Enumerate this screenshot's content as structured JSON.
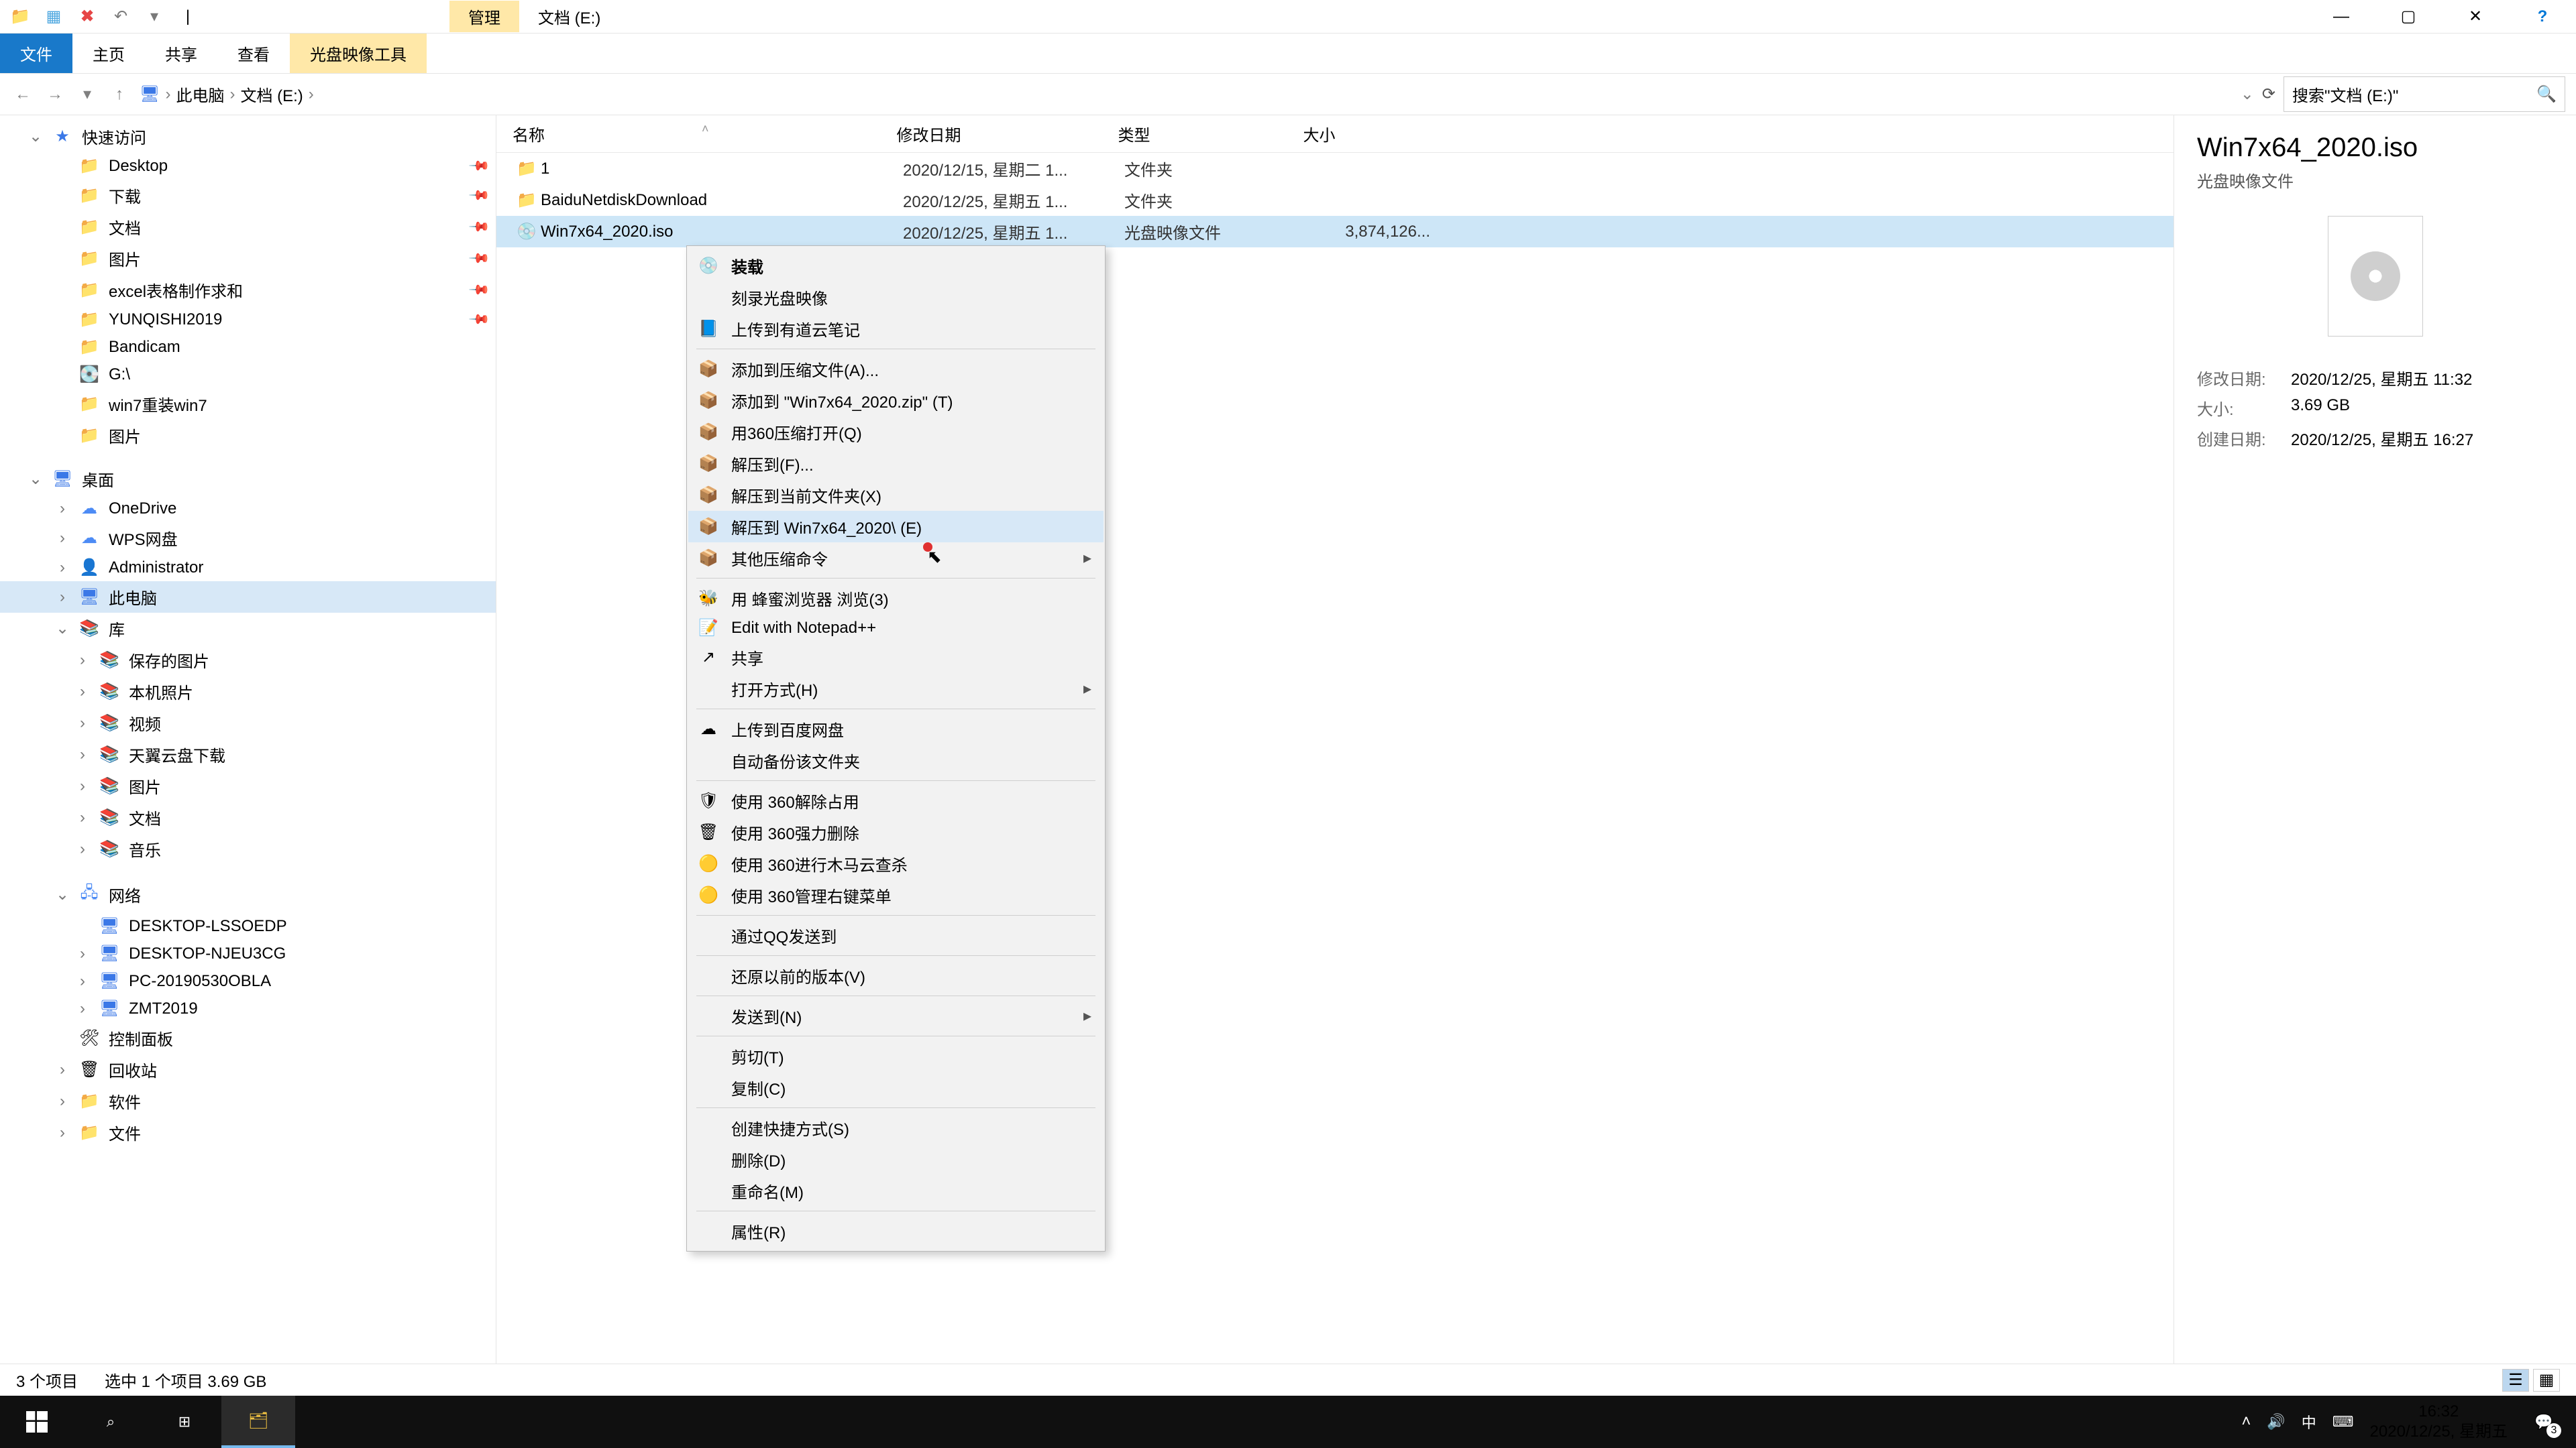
{
  "title_tab": "管理",
  "title_path": "文档 (E:)",
  "win_controls": {
    "min": "—",
    "max": "▢",
    "close": "✕",
    "help": "?"
  },
  "ribbon": {
    "file": "文件",
    "home": "主页",
    "share": "共享",
    "view": "查看",
    "context": "光盘映像工具"
  },
  "nav": {
    "back": "←",
    "forward": "→",
    "up": "↑"
  },
  "breadcrumb": [
    "此电脑",
    "文档 (E:)"
  ],
  "search_placeholder": "搜索\"文档 (E:)\"",
  "columns": {
    "name": "名称",
    "date": "修改日期",
    "type": "类型",
    "size": "大小"
  },
  "rows": [
    {
      "icon": "folder",
      "name": "1",
      "date": "2020/12/15, 星期二 1...",
      "type": "文件夹",
      "size": ""
    },
    {
      "icon": "folder",
      "name": "BaiduNetdiskDownload",
      "date": "2020/12/25, 星期五 1...",
      "type": "文件夹",
      "size": ""
    },
    {
      "icon": "iso",
      "name": "Win7x64_2020.iso",
      "date": "2020/12/25, 星期五 1...",
      "type": "光盘映像文件",
      "size": "3,874,126..."
    }
  ],
  "tree": [
    {
      "d": 0,
      "icon": "star",
      "label": "快速访问",
      "chev": "v"
    },
    {
      "d": 1,
      "icon": "folder-blue",
      "label": "Desktop",
      "pin": true
    },
    {
      "d": 1,
      "icon": "folder-blue",
      "label": "下载",
      "pin": true
    },
    {
      "d": 1,
      "icon": "folder-blue",
      "label": "文档",
      "pin": true
    },
    {
      "d": 1,
      "icon": "folder-blue",
      "label": "图片",
      "pin": true
    },
    {
      "d": 1,
      "icon": "folder-yellow",
      "label": "excel表格制作求和",
      "pin": true
    },
    {
      "d": 1,
      "icon": "folder-yellow",
      "label": "YUNQISHI2019",
      "pin": true
    },
    {
      "d": 1,
      "icon": "folder-yellow",
      "label": "Bandicam"
    },
    {
      "d": 1,
      "icon": "drive",
      "label": "G:\\"
    },
    {
      "d": 1,
      "icon": "folder-yellow",
      "label": "win7重装win7"
    },
    {
      "d": 1,
      "icon": "folder-yellow",
      "label": "图片"
    },
    {
      "d": 0,
      "icon": "monitor",
      "label": "桌面",
      "chev": "v"
    },
    {
      "d": 1,
      "icon": "cloud",
      "label": "OneDrive",
      "chev": ">"
    },
    {
      "d": 1,
      "icon": "cloud",
      "label": "WPS网盘",
      "chev": ">"
    },
    {
      "d": 1,
      "icon": "user",
      "label": "Administrator",
      "chev": ">"
    },
    {
      "d": 1,
      "icon": "monitor",
      "label": "此电脑",
      "sel": true,
      "chev": ">"
    },
    {
      "d": 1,
      "icon": "lib",
      "label": "库",
      "chev": "v"
    },
    {
      "d": 2,
      "icon": "lib",
      "label": "保存的图片",
      "chev": ">"
    },
    {
      "d": 2,
      "icon": "lib",
      "label": "本机照片",
      "chev": ">"
    },
    {
      "d": 2,
      "icon": "lib",
      "label": "视频",
      "chev": ">"
    },
    {
      "d": 2,
      "icon": "lib",
      "label": "天翼云盘下载",
      "chev": ">"
    },
    {
      "d": 2,
      "icon": "lib",
      "label": "图片",
      "chev": ">"
    },
    {
      "d": 2,
      "icon": "lib",
      "label": "文档",
      "chev": ">"
    },
    {
      "d": 2,
      "icon": "lib",
      "label": "音乐",
      "chev": ">"
    },
    {
      "d": 1,
      "icon": "net",
      "label": "网络",
      "chev": "v"
    },
    {
      "d": 2,
      "icon": "monitor",
      "label": "DESKTOP-LSSOEDP"
    },
    {
      "d": 2,
      "icon": "monitor",
      "label": "DESKTOP-NJEU3CG",
      "chev": ">"
    },
    {
      "d": 2,
      "icon": "monitor",
      "label": "PC-20190530OBLA",
      "chev": ">"
    },
    {
      "d": 2,
      "icon": "monitor",
      "label": "ZMT2019",
      "chev": ">"
    },
    {
      "d": 1,
      "icon": "panel",
      "label": "控制面板"
    },
    {
      "d": 1,
      "icon": "bin",
      "label": "回收站",
      "chev": ">"
    },
    {
      "d": 1,
      "icon": "folder-yellow",
      "label": "软件",
      "chev": ">"
    },
    {
      "d": 1,
      "icon": "folder-yellow",
      "label": "文件",
      "chev": ">"
    }
  ],
  "ctx": [
    {
      "t": "item",
      "icon": "disc",
      "label": "装载",
      "bold": true
    },
    {
      "t": "item",
      "label": "刻录光盘映像"
    },
    {
      "t": "item",
      "icon": "note",
      "label": "上传到有道云笔记"
    },
    {
      "t": "sep"
    },
    {
      "t": "item",
      "icon": "zip",
      "label": "添加到压缩文件(A)..."
    },
    {
      "t": "item",
      "icon": "zip",
      "label": "添加到 \"Win7x64_2020.zip\" (T)"
    },
    {
      "t": "item",
      "icon": "zip",
      "label": "用360压缩打开(Q)"
    },
    {
      "t": "item",
      "icon": "zip",
      "label": "解压到(F)..."
    },
    {
      "t": "item",
      "icon": "zip",
      "label": "解压到当前文件夹(X)"
    },
    {
      "t": "item",
      "icon": "zip",
      "label": "解压到 Win7x64_2020\\ (E)",
      "hl": true
    },
    {
      "t": "item",
      "icon": "zip",
      "label": "其他压缩命令",
      "sub": true
    },
    {
      "t": "sep"
    },
    {
      "t": "item",
      "icon": "bee",
      "label": "用 蜂蜜浏览器 浏览(3)"
    },
    {
      "t": "item",
      "icon": "npp",
      "label": "Edit with Notepad++"
    },
    {
      "t": "item",
      "icon": "share",
      "label": "共享"
    },
    {
      "t": "item",
      "label": "打开方式(H)",
      "sub": true
    },
    {
      "t": "sep"
    },
    {
      "t": "item",
      "icon": "baidu",
      "label": "上传到百度网盘"
    },
    {
      "t": "item",
      "label": "自动备份该文件夹",
      "dis": true
    },
    {
      "t": "sep"
    },
    {
      "t": "item",
      "icon": "360",
      "label": "使用 360解除占用"
    },
    {
      "t": "item",
      "icon": "360d",
      "label": "使用 360强力删除"
    },
    {
      "t": "item",
      "icon": "360s",
      "label": "使用 360进行木马云查杀"
    },
    {
      "t": "item",
      "icon": "360s",
      "label": "使用 360管理右键菜单"
    },
    {
      "t": "sep"
    },
    {
      "t": "item",
      "label": "通过QQ发送到"
    },
    {
      "t": "sep"
    },
    {
      "t": "item",
      "label": "还原以前的版本(V)"
    },
    {
      "t": "sep"
    },
    {
      "t": "item",
      "label": "发送到(N)",
      "sub": true
    },
    {
      "t": "sep"
    },
    {
      "t": "item",
      "label": "剪切(T)"
    },
    {
      "t": "item",
      "label": "复制(C)"
    },
    {
      "t": "sep"
    },
    {
      "t": "item",
      "label": "创建快捷方式(S)"
    },
    {
      "t": "item",
      "label": "删除(D)"
    },
    {
      "t": "item",
      "label": "重命名(M)"
    },
    {
      "t": "sep"
    },
    {
      "t": "item",
      "label": "属性(R)"
    }
  ],
  "details": {
    "title": "Win7x64_2020.iso",
    "type": "光盘映像文件",
    "mod_k": "修改日期:",
    "mod_v": "2020/12/25, 星期五 11:32",
    "size_k": "大小:",
    "size_v": "3.69 GB",
    "create_k": "创建日期:",
    "create_v": "2020/12/25, 星期五 16:27"
  },
  "status": {
    "count": "3 个项目",
    "sel": "选中 1 个项目  3.69 GB"
  },
  "taskbar": {
    "ime": "中",
    "time": "16:32",
    "date": "2020/12/25, 星期五",
    "notif": "3"
  }
}
